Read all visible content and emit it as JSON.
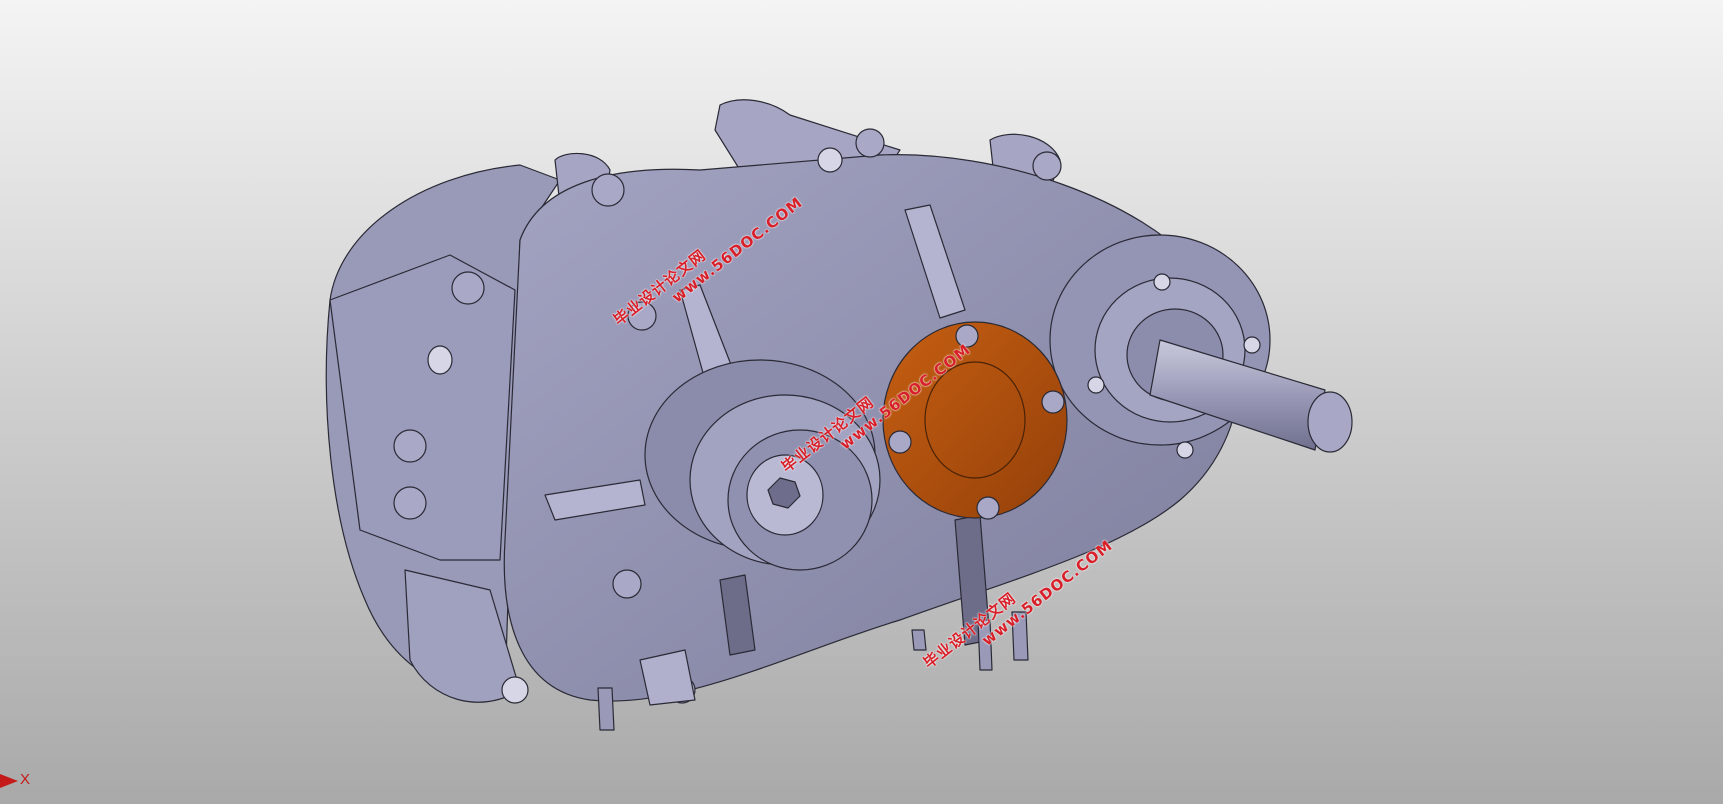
{
  "viewport": {
    "background_top": "#f4f4f4",
    "background_bottom": "#a9a9a9"
  },
  "model": {
    "body_color": "#8f8fb0",
    "cover_color": "#b04f0a",
    "edge_color": "#2a2a36"
  },
  "watermarks": [
    {
      "line1": "www.56DOC.COM",
      "line2": "毕业设计论文网"
    },
    {
      "line1": "www.56DOC.COM",
      "line2": "毕业设计论文网"
    },
    {
      "line1": "www.56DOC.COM",
      "line2": "毕业设计论文网"
    }
  ],
  "axis_triad": {
    "x_label": "X",
    "x_color": "#c51a1a"
  }
}
